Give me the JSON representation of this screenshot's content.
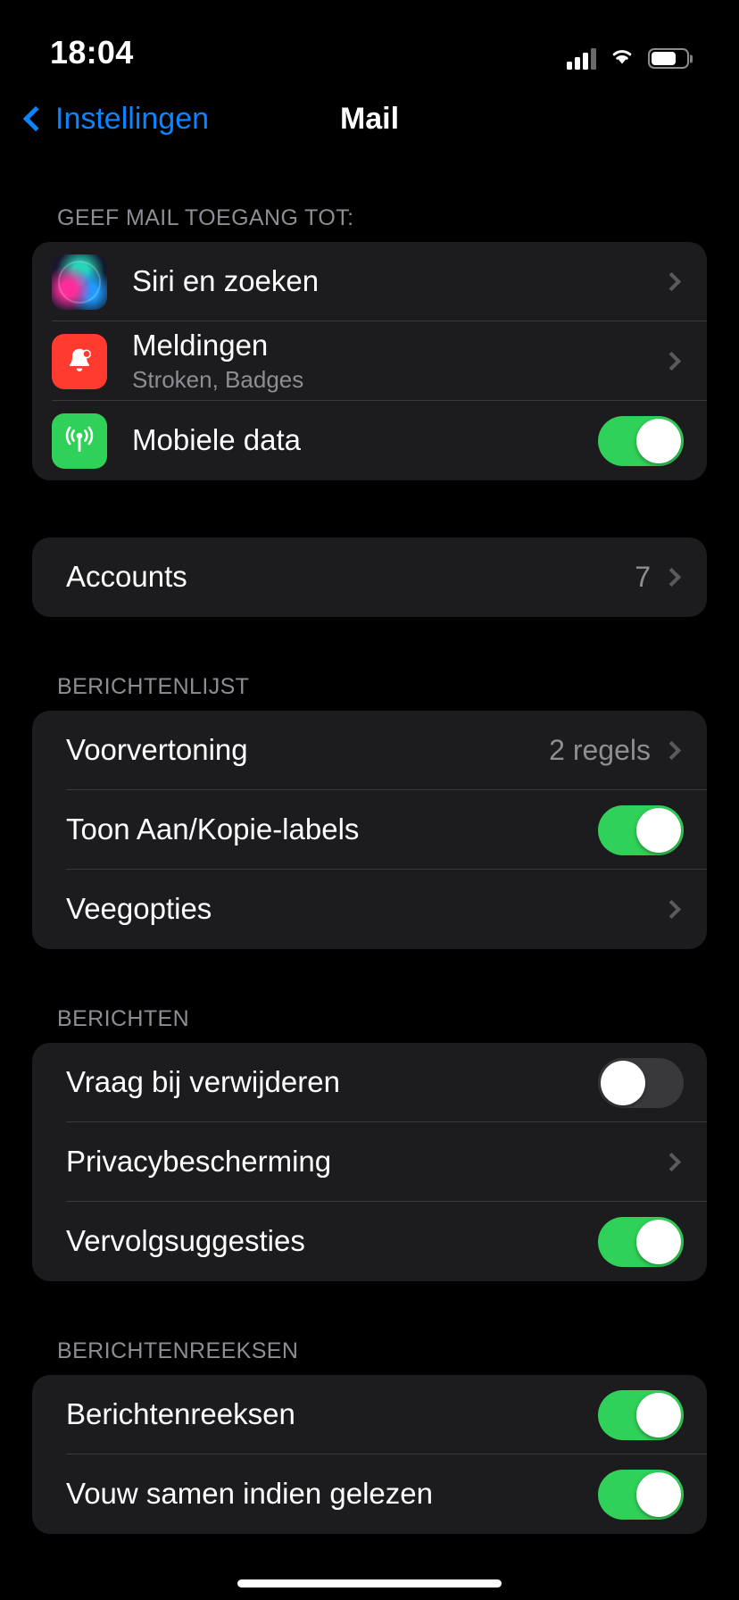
{
  "status_bar": {
    "time": "18:04",
    "signal_icon": "cellular-signal-icon",
    "wifi_icon": "wifi-icon",
    "battery_icon": "battery-icon"
  },
  "nav": {
    "back_label": "Instellingen",
    "back_icon": "chevron-left-icon",
    "title": "Mail"
  },
  "colors": {
    "accent_blue": "#0a84ff",
    "toggle_on_green": "#30d158",
    "card_background": "#1c1c1e",
    "page_background": "#000000",
    "secondary_text": "#8d8d93",
    "notification_red": "#ff3b30"
  },
  "sections": [
    {
      "header": "GEEF MAIL TOEGANG TOT:",
      "rows": [
        {
          "label": "Siri en zoeken",
          "icon": "siri-icon",
          "accessory": "chevron"
        },
        {
          "label": "Meldingen",
          "sublabel": "Stroken, Badges",
          "icon": "bell-icon",
          "accessory": "chevron"
        },
        {
          "label": "Mobiele data",
          "icon": "cellular-data-icon",
          "accessory": "toggle",
          "toggle_on": true
        }
      ]
    },
    {
      "header": "",
      "rows": [
        {
          "label": "Accounts",
          "value": "7",
          "accessory": "chevron"
        }
      ]
    },
    {
      "header": "BERICHTENLIJST",
      "rows": [
        {
          "label": "Voorvertoning",
          "value": "2 regels",
          "accessory": "chevron"
        },
        {
          "label": "Toon Aan/Kopie-labels",
          "accessory": "toggle",
          "toggle_on": true
        },
        {
          "label": "Veegopties",
          "accessory": "chevron"
        }
      ]
    },
    {
      "header": "BERICHTEN",
      "rows": [
        {
          "label": "Vraag bij verwijderen",
          "accessory": "toggle",
          "toggle_on": false
        },
        {
          "label": "Privacybescherming",
          "accessory": "chevron"
        },
        {
          "label": "Vervolgsuggesties",
          "accessory": "toggle",
          "toggle_on": true
        }
      ]
    },
    {
      "header": "BERICHTENREEKSEN",
      "rows": [
        {
          "label": "Berichtenreeksen",
          "accessory": "toggle",
          "toggle_on": true
        },
        {
          "label": "Vouw samen indien gelezen",
          "accessory": "toggle",
          "toggle_on": true
        }
      ]
    }
  ]
}
